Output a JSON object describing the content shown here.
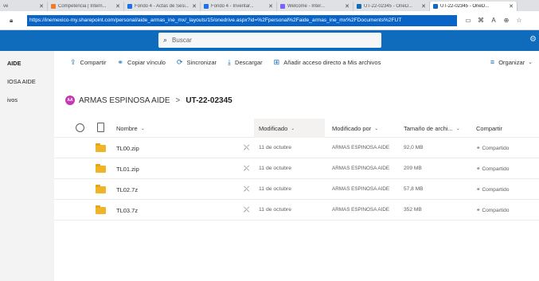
{
  "browser": {
    "tabs": [
      {
        "label": "ve",
        "color": "#9aa0a6"
      },
      {
        "label": "Competencia | Intern...",
        "color": "#f07c2a"
      },
      {
        "label": "Fondo 4 - Actas de Sesi...",
        "color": "#1a73e8"
      },
      {
        "label": "Fondo 4 - Inventar...",
        "color": "#1a73e8"
      },
      {
        "label": "Welcome - Inter...",
        "color": "#7b61ff"
      },
      {
        "label": "UT-22-02345 - OneD...",
        "color": "#0f6cbd"
      },
      {
        "label": "UT-22-02345 - OneD...",
        "color": "#0f6cbd"
      }
    ],
    "url": "https://inemexico-my.sharepoint.com/personal/aide_armas_ine_mx/_layouts/15/onedrive.aspx?id=%2Fpersonal%2Faide_armas_ine_mx%2FDocuments%2FUT"
  },
  "suite": {
    "search_placeholder": "Buscar"
  },
  "leftnav": {
    "items": [
      "AIDE",
      "IOSA AIDE",
      "ivos"
    ]
  },
  "commands": {
    "share": "Compartir",
    "copy_link": "Copiar vínculo",
    "sync": "Sincronizar",
    "download": "Descargar",
    "shortcut": "Añadir acceso directo a Mis archivos",
    "organize": "Organizar"
  },
  "breadcrumb": {
    "initials": "AA",
    "owner": "ARMAS ESPINOSA AIDE",
    "separator": ">",
    "folder": "UT-22-02345"
  },
  "columns": {
    "name": "Nombre",
    "modified": "Modificado",
    "modified_by": "Modificado por",
    "size": "Tamaño de archi...",
    "sharing": "Compartir"
  },
  "files": [
    {
      "name": "TL00.zip",
      "modified": "11 de octubre",
      "modified_by": "ARMAS ESPINOSA AIDE",
      "size": "92,0 MB",
      "sharing": "Compartido"
    },
    {
      "name": "TL01.zip",
      "modified": "11 de octubre",
      "modified_by": "ARMAS ESPINOSA AIDE",
      "size": "209 MB",
      "sharing": "Compartido"
    },
    {
      "name": "TL02.7z",
      "modified": "11 de octubre",
      "modified_by": "ARMAS ESPINOSA AIDE",
      "size": "57,8 MB",
      "sharing": "Compartido"
    },
    {
      "name": "TL03.7z",
      "modified": "11 de octubre",
      "modified_by": "ARMAS ESPINOSA AIDE",
      "size": "352 MB",
      "sharing": "Compartido"
    }
  ],
  "colors": {
    "brand": "#0f6cbd",
    "folder": "#f0b429",
    "avatar": "#c239b3",
    "selection": "#0a64c8"
  },
  "icons": {
    "sync_status": "sync-arrows-icon",
    "share_status": "link-icon"
  }
}
